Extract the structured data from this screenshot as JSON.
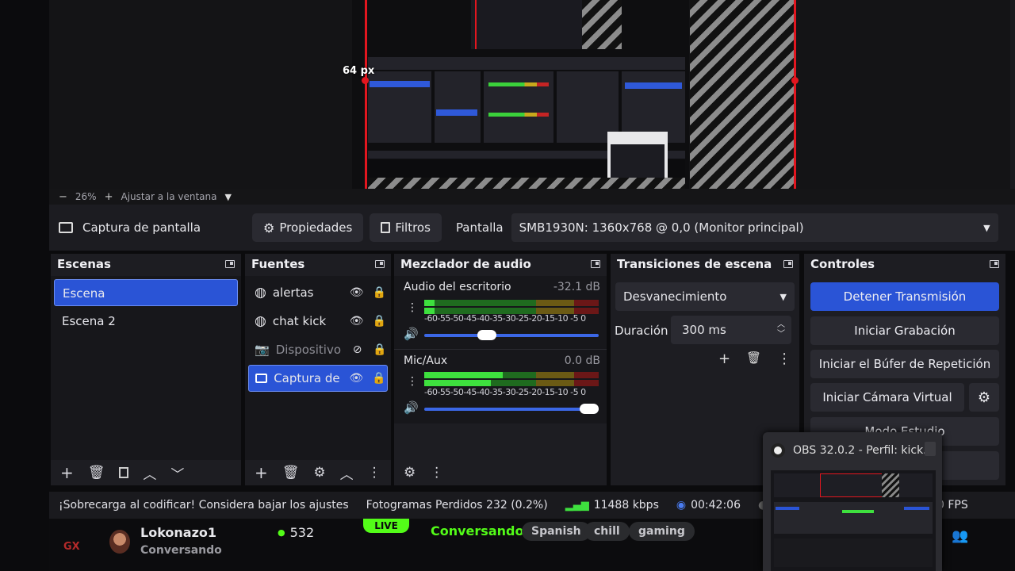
{
  "preview": {
    "overlay_label": "64 px"
  },
  "zoombar": {
    "minus": "−",
    "zoom": "26%",
    "plus": "+",
    "fit_label": "Ajustar a la ventana"
  },
  "source_toolbar": {
    "source_name": "Captura de pantalla",
    "properties_label": "Propiedades",
    "filters_label": "Filtros",
    "display_label": "Pantalla",
    "display_value": "SMB1930N: 1360x768 @ 0,0 (Monitor principal)"
  },
  "scenes": {
    "title": "Escenas",
    "items": [
      {
        "label": "Escena",
        "selected": true
      },
      {
        "label": "Escena 2",
        "selected": false
      }
    ]
  },
  "sources": {
    "title": "Fuentes",
    "items": [
      {
        "label": "alertas",
        "icon": "browser-icon"
      },
      {
        "label": "chat kick",
        "icon": "browser-icon"
      },
      {
        "label": "Dispositivo",
        "icon": "camera-icon",
        "hidden": true
      },
      {
        "label": "Captura de",
        "icon": "monitor-icon",
        "selected": true
      }
    ]
  },
  "mixer": {
    "title": "Mezclador de audio",
    "channels": [
      {
        "name": "Audio del escritorio",
        "db": "-32.1 dB",
        "level": 0.06,
        "volume": 0.36
      },
      {
        "name": "Mic/Aux",
        "db": "0.0 dB",
        "level": 0.45,
        "volume": 0.95
      }
    ],
    "ticks": "-60-55-50-45-40-35-30-25-20-15-10 -5  0"
  },
  "transitions": {
    "title": "Transiciones de escena",
    "type": "Desvanecimiento",
    "duration_label": "Duración",
    "duration_value": "300 ms"
  },
  "controls": {
    "title": "Controles",
    "stop_stream": "Detener Transmisión",
    "start_recording": "Iniciar Grabación",
    "replay_buffer": "Iniciar el Búfer de Repetición",
    "virtual_camera": "Iniciar Cámara Virtual",
    "studio_mode": "Modo Estudio"
  },
  "statusbar": {
    "warning": "¡Sobrecarga al codificar! Considera bajar los ajustes",
    "dropped_frames": "Fotogramas Perdidos 232 (0.2%)",
    "bitrate": "11488 kbps",
    "stream_time": "00:42:06",
    "rec_time": "00",
    "fps": "0 FPS"
  },
  "popup": {
    "title": "OBS 32.0.2 - Perfil: kick..."
  },
  "kick": {
    "logo": "GX",
    "username": "Lokonazo1",
    "status": "Conversando",
    "viewers": "532",
    "live_badge": "LIVE",
    "category": "Conversando",
    "tags": [
      "Spanish",
      "chill",
      "gaming"
    ]
  },
  "colors": {
    "accent_blue": "#2a54d6",
    "meter_green": "#3ee03e",
    "preview_red": "#e2161f",
    "kick_green": "#53fc18"
  }
}
